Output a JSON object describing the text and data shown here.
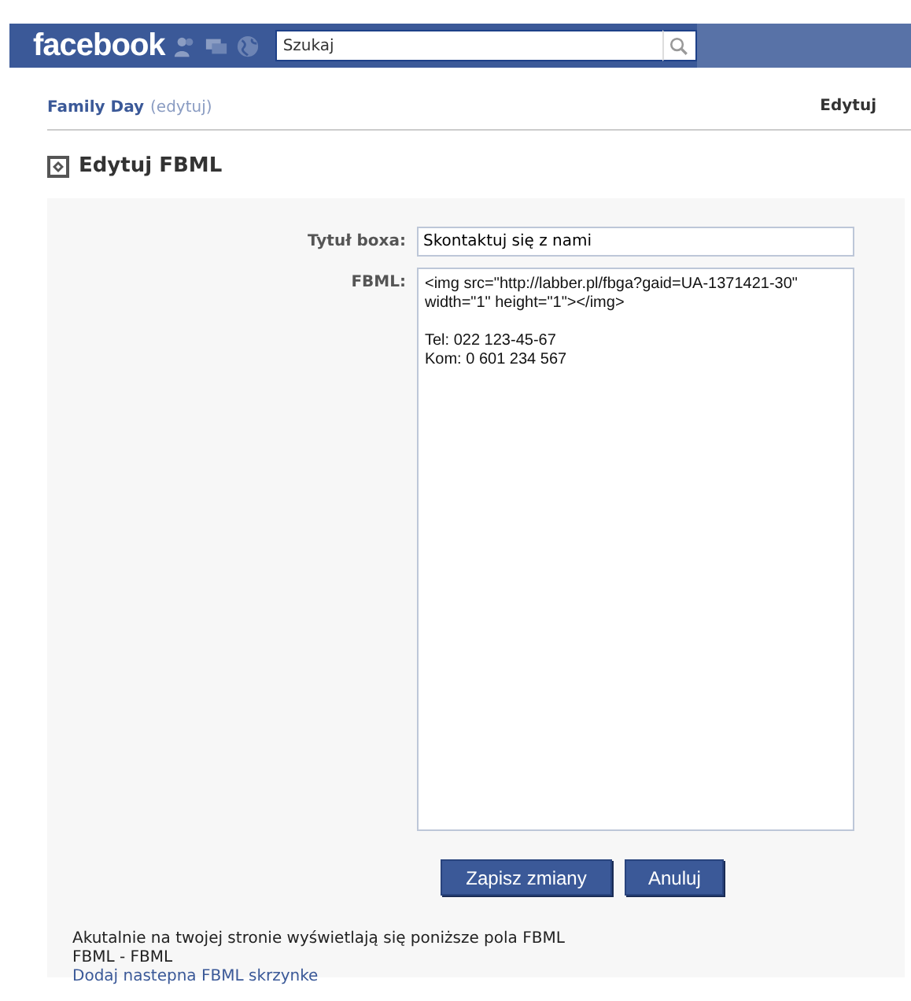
{
  "topbar": {
    "logo": "facebook",
    "search": {
      "placeholder": "Szukaj"
    }
  },
  "page_header": {
    "name": "Family Day",
    "edit_link": "(edytuj)",
    "right_link": "Edytuj"
  },
  "section_title": "Edytuj FBML",
  "form": {
    "fields": [
      {
        "kind": "input",
        "label": "Tytuł boxa:",
        "value": "Skontaktuj się z nami"
      },
      {
        "kind": "textarea",
        "label": "FBML:",
        "value": "<img src=\"http://labber.pl/fbga?gaid=UA-1371421-30\" width=\"1\" height=\"1\"></img>\n\nTel: 022 123-45-67\nKom: 0 601 234 567"
      }
    ],
    "buttons": [
      "Zapisz zmiany",
      "Anuluj"
    ]
  },
  "footer": {
    "info": "Akutalnie na twojej stronie wyświetlają się poniższe pola FBML",
    "entry": "FBML - FBML",
    "link": "Dodaj nastepna FBML skrzynke"
  }
}
